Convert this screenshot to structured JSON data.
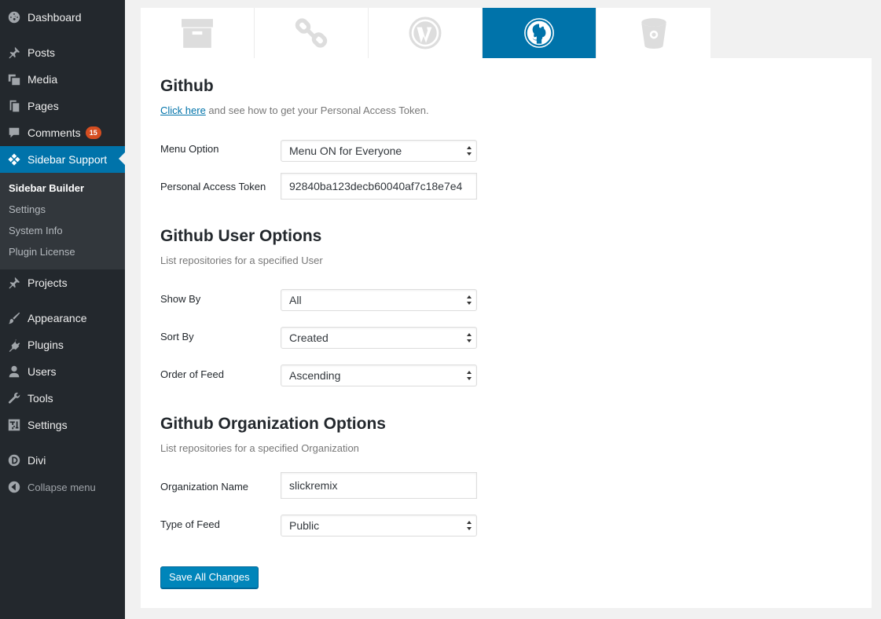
{
  "sidebar": {
    "items": [
      {
        "key": "dashboard",
        "label": "Dashboard",
        "icon": "dashboard-icon"
      },
      {
        "key": "posts",
        "label": "Posts",
        "icon": "pin-icon"
      },
      {
        "key": "media",
        "label": "Media",
        "icon": "media-icon"
      },
      {
        "key": "pages",
        "label": "Pages",
        "icon": "pages-icon"
      },
      {
        "key": "comments",
        "label": "Comments",
        "icon": "comment-icon",
        "badge": "15"
      },
      {
        "key": "sidebar-support",
        "label": "Sidebar Support",
        "icon": "sidebar-support-icon"
      },
      {
        "key": "projects",
        "label": "Projects",
        "icon": "pin-icon"
      },
      {
        "key": "appearance",
        "label": "Appearance",
        "icon": "brush-icon"
      },
      {
        "key": "plugins",
        "label": "Plugins",
        "icon": "plug-icon"
      },
      {
        "key": "users",
        "label": "Users",
        "icon": "user-icon"
      },
      {
        "key": "tools",
        "label": "Tools",
        "icon": "wrench-icon"
      },
      {
        "key": "settings",
        "label": "Settings",
        "icon": "settings-icon"
      },
      {
        "key": "divi",
        "label": "Divi",
        "icon": "divi-icon"
      }
    ],
    "submenu": [
      "Sidebar Builder",
      "Settings",
      "System Info",
      "Plugin License"
    ],
    "collapse_label": "Collapse menu"
  },
  "tabs": [
    {
      "icon": "archive-box-icon"
    },
    {
      "icon": "link-icon"
    },
    {
      "icon": "wordpress-icon"
    },
    {
      "icon": "github-icon"
    },
    {
      "icon": "bucket-icon"
    }
  ],
  "github": {
    "title": "Github",
    "link_text": "Click here",
    "link_suffix": " and see how to get your Personal Access Token.",
    "menu_option_label": "Menu Option",
    "menu_option_value": "Menu ON for Everyone",
    "token_label": "Personal Access Token",
    "token_value": "92840ba123decb60040af7c18e7e4"
  },
  "user_options": {
    "title": "Github User Options",
    "desc": "List repositories for a specified User",
    "show_by_label": "Show By",
    "show_by_value": "All",
    "sort_by_label": "Sort By",
    "sort_by_value": "Created",
    "order_label": "Order of Feed",
    "order_value": "Ascending"
  },
  "org_options": {
    "title": "Github Organization Options",
    "desc": "List repositories for a specified Organization",
    "org_name_label": "Organization Name",
    "org_name_value": "slickremix",
    "type_label": "Type of Feed",
    "type_value": "Public"
  },
  "save_label": "Save All Changes",
  "colors": {
    "sidebar_bg": "#23282d",
    "submenu_bg": "#32373c",
    "accent": "#0073aa",
    "button": "#0085ba",
    "badge": "#d54e21"
  }
}
